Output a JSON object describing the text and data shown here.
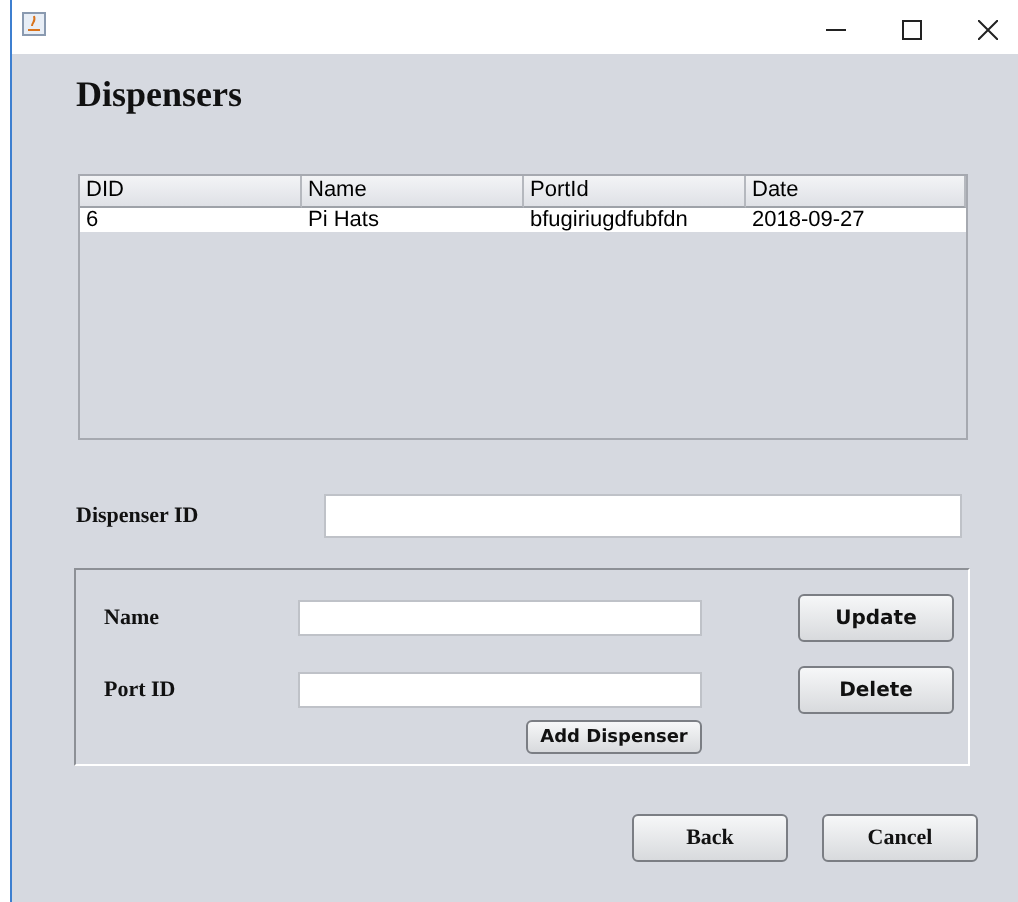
{
  "heading": "Dispensers",
  "table": {
    "columns": [
      "DID",
      "Name",
      "PortId",
      "Date"
    ],
    "rows": [
      {
        "cells": [
          "6",
          "Pi Hats",
          "bfugiriugdfubfdn",
          "2018-09-27"
        ],
        "selected": false
      }
    ]
  },
  "dispenser_id": {
    "label": "Dispenser ID"
  },
  "form": {
    "fields": [
      {
        "label": "Name"
      },
      {
        "label": "Port ID"
      }
    ],
    "side_buttons": [
      "Update",
      "Delete"
    ],
    "add_button": "Add Dispenser"
  },
  "buttons": [
    "Back",
    "Cancel"
  ]
}
